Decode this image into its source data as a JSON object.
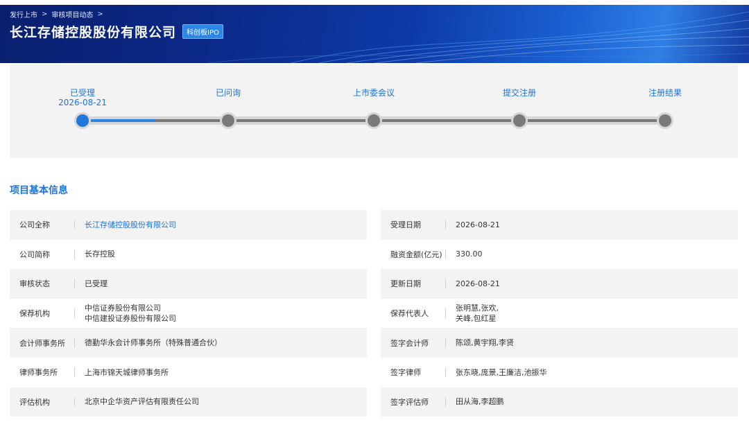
{
  "breadcrumb": [
    "发行上市",
    "审核项目动态"
  ],
  "breadcrumb_sep": ">",
  "company": {
    "title": "长江存储控股股份有限公司",
    "board": "科创板IPO"
  },
  "stages": [
    {
      "label": "已受理",
      "date": "2026-08-21",
      "status": "current"
    },
    {
      "label": "已问询",
      "date": ""
    },
    {
      "label": "上市委会议",
      "date": ""
    },
    {
      "label": "提交注册",
      "date": ""
    },
    {
      "label": "注册结果",
      "date": ""
    }
  ],
  "colors": {
    "accent": "#1f72d6",
    "banner": "#0b2a8a",
    "progress_active": "#1f78dc"
  },
  "section_title": "项目基本信息",
  "left_info": [
    {
      "key": "公司全称",
      "value": "长江存储控股股份有限公司"
    },
    {
      "key": "公司简称",
      "value": "长存控股"
    },
    {
      "key": "审核状态",
      "value": "已受理"
    },
    {
      "key": "保荐机构",
      "value": "中信证券股份有限公司",
      "value2": "中信建投证券股份有限公司"
    },
    {
      "key": "会计师事务所",
      "value": "德勤华永会计师事务所（特殊普通合伙）"
    },
    {
      "key": "律师事务所",
      "value": "上海市锦天城律师事务所"
    },
    {
      "key": "评估机构",
      "value": "北京中企华资产评估有限责任公司"
    }
  ],
  "right_info": [
    {
      "key": "受理日期",
      "value": "2026-08-21"
    },
    {
      "key": "融资金额(亿元)",
      "value": "330.00"
    },
    {
      "key": "更新日期",
      "value": "2026-08-21"
    },
    {
      "key": "保荐代表人",
      "value": "张明慧,张欢,",
      "value2": "关峰,包红星"
    },
    {
      "key": "签字会计师",
      "value": "陈颂,黄宇翔,李贤"
    },
    {
      "key": "签字律师",
      "value": "张东晓,庞景,王廉洁,池振华"
    },
    {
      "key": "签字评估师",
      "value": "田从海,李超鹏"
    }
  ]
}
